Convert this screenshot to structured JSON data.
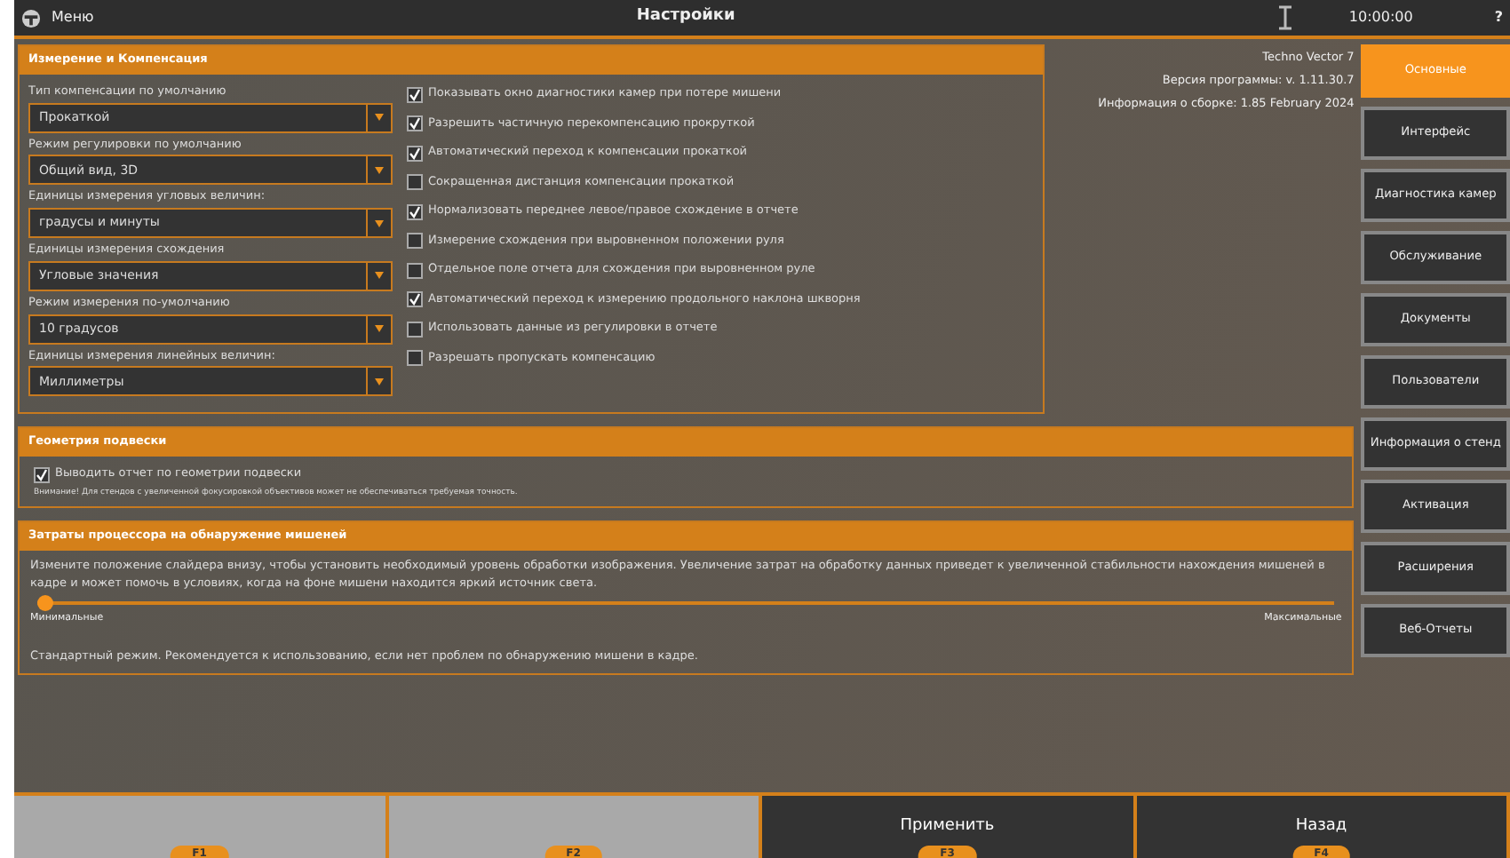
{
  "title_bar": {
    "menu": "Меню",
    "title": "Настройки",
    "time": "10:00:00",
    "help": "?"
  },
  "measurement": {
    "title": "Измерение и Компенсация",
    "dropdowns": [
      {
        "label": "Тип компенсации по умолчанию",
        "value": "Прокаткой"
      },
      {
        "label": "Режим регулировки по умолчанию",
        "value": "Общий вид, 3D"
      },
      {
        "label": "Единицы измерения угловых величин:",
        "value": "градусы и минуты"
      },
      {
        "label": "Единицы измерения схождения",
        "value": "Угловые значения"
      },
      {
        "label": "Режим измерения по-умолчанию",
        "value": "10 градусов"
      },
      {
        "label": "Единицы измерения линейных величин:",
        "value": "Миллиметры"
      }
    ],
    "checkboxes": [
      {
        "label": "Показывать окно диагностики камер при потере мишени",
        "checked": true
      },
      {
        "label": "Разрешить частичную перекомпенсацию прокруткой",
        "checked": true
      },
      {
        "label": "Автоматический переход к компенсации прокаткой",
        "checked": true
      },
      {
        "label": "Сокращенная дистанция компенсации прокаткой",
        "checked": false
      },
      {
        "label": "Нормализовать переднее левое/правое схождение в отчете",
        "checked": true
      },
      {
        "label": "Измерение схождения при выровненном положении руля",
        "checked": false
      },
      {
        "label": "Отдельное поле отчета для схождения при выровненном руле",
        "checked": false
      },
      {
        "label": "Автоматический переход к измерению продольного наклона шкворня",
        "checked": true
      },
      {
        "label": "Использовать данные из регулировки в отчете",
        "checked": false
      },
      {
        "label": "Разрешать пропускать компенсацию",
        "checked": false
      }
    ]
  },
  "info": [
    "Techno Vector 7",
    "Версия программы:  v. 1.11.30.7",
    "Информация о сборке:  1.85 February 2024"
  ],
  "suspension": {
    "title": "Геометрия подвески",
    "checkbox": {
      "label": "Выводить отчет по геометрии подвески",
      "checked": true
    },
    "note": "Внимание! Для стендов с увеличенной фокусировкой объективов может не обеспечиваться требуемая точность."
  },
  "cpu": {
    "title": "Затраты процессора на обнаружение мишеней",
    "description": "Измените положение слайдера внизу, чтобы установить необходимый уровень обработки изображения. Увеличение затрат на обработку данных приведет к увеличенной стабильности нахождения мишеней в кадре и может помочь в условиях, когда на фоне мишени находится яркий источник света.",
    "slider": {
      "level": 0
    },
    "min_label": "Минимальные",
    "max_label": "Максимальные",
    "status": "Стандартный режим. Рекомендуется к использованию, если нет проблем по обнаружению мишени в кадре."
  },
  "nav": [
    {
      "label": "Основные",
      "selected": true
    },
    {
      "label": "Интерфейс",
      "selected": false
    },
    {
      "label": "Диагностика камер",
      "selected": false
    },
    {
      "label": "Обслуживание",
      "selected": false
    },
    {
      "label": "Документы",
      "selected": false
    },
    {
      "label": "Пользователи",
      "selected": false
    },
    {
      "label": "Информация о стенд",
      "selected": false
    },
    {
      "label": "Активация",
      "selected": false
    },
    {
      "label": "Расширения",
      "selected": false
    },
    {
      "label": "Веб-Отчеты",
      "selected": false
    }
  ],
  "footer": [
    {
      "key": "F1",
      "enabled": false
    },
    {
      "key": "F2",
      "enabled": false
    },
    {
      "key": "F3",
      "label": "Применить",
      "enabled": true
    },
    {
      "key": "F4",
      "label": "Назад",
      "enabled": true
    }
  ]
}
